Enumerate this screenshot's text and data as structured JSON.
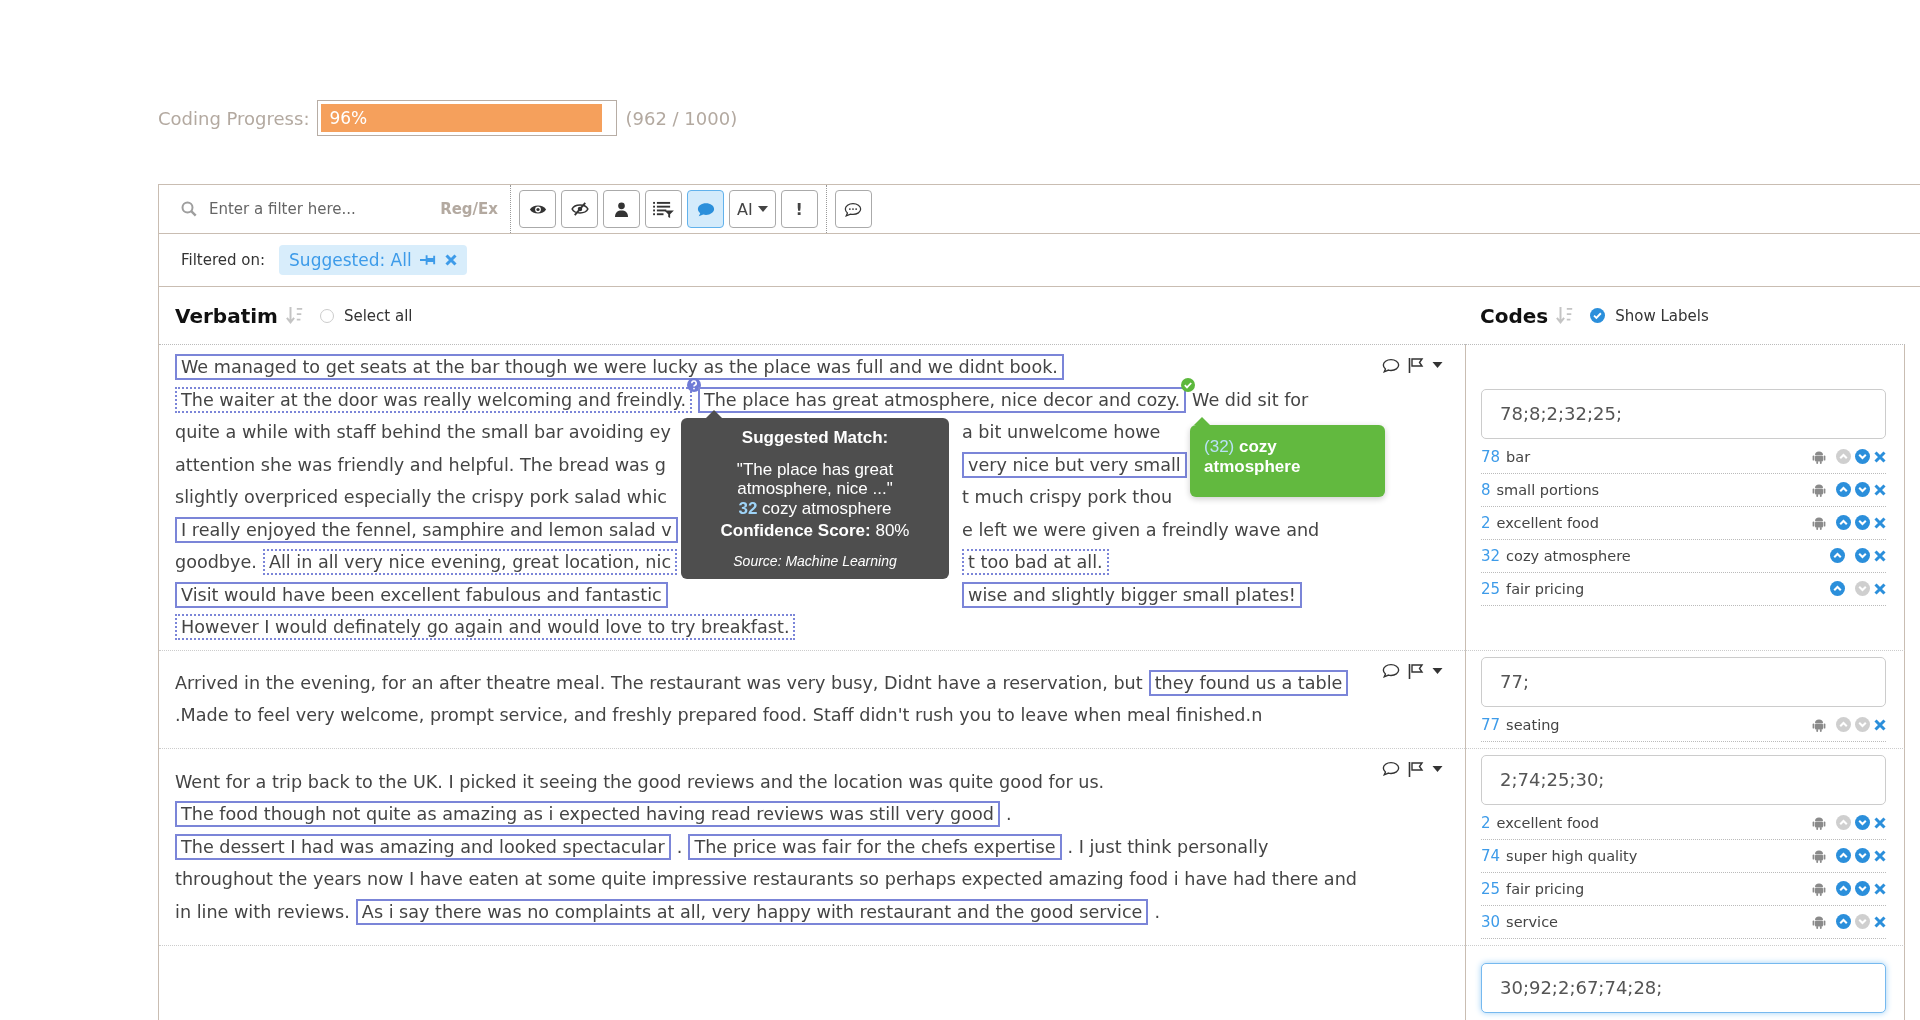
{
  "progress": {
    "label": "Coding Progress:",
    "level": 0.96,
    "percent": "96%",
    "count": "(962 / 1000)"
  },
  "toolbar": {
    "search_placeholder": "Enter a filter here...",
    "regex_label": "Reg/Ex",
    "buttons": [
      {
        "kind": "eye",
        "selected": false
      },
      {
        "kind": "eye-slash",
        "selected": false
      },
      {
        "kind": "user",
        "selected": false
      },
      {
        "kind": "list-filter",
        "selected": false
      },
      {
        "kind": "comment",
        "selected": true
      },
      {
        "kind": "dropdown",
        "label": "AI",
        "selected": false
      },
      {
        "kind": "text",
        "label": "!",
        "selected": false
      }
    ]
  },
  "filter": {
    "label": "Filtered on:",
    "chip": "Suggested: All"
  },
  "verbatim_header": {
    "title": "Verbatim",
    "select_all": "Select all",
    "checked": false
  },
  "codes_header": {
    "title": "Codes",
    "show_labels": "Show Labels",
    "checked": true
  },
  "rows": [
    {
      "lines": [
        {
          "segments": [
            {
              "text": "We managed to get seats at the bar though we were lucky as the place was full and we didnt book.",
              "kind": "solid"
            }
          ]
        },
        {
          "segments": [
            {
              "text": "The waiter at the door was really welcoming and freindly.",
              "kind": "dotted",
              "suggested": true
            },
            {
              "text": "The place has great atmosphere, nice decor and cozy.",
              "kind": "solid",
              "confirmed": true
            },
            {
              "text": "We did sit for",
              "kind": "plain"
            }
          ]
        },
        {
          "segments": [
            {
              "text": "quite a while with staff behind the small bar avoiding ey",
              "kind": "plain"
            }
          ],
          "after_gap": [
            {
              "text": "a bit unwelcome howe",
              "kind": "plain"
            }
          ]
        },
        {
          "segments": [
            {
              "text": "attention she was friendly and helpful. The bread was g",
              "kind": "plain"
            }
          ],
          "after_gap": [
            {
              "text": "very nice but very small",
              "kind": "solid"
            }
          ]
        },
        {
          "segments": [
            {
              "text": "slightly overpriced especially the crispy pork salad whic",
              "kind": "plain"
            }
          ],
          "after_gap": [
            {
              "text": "t much crispy pork thou",
              "kind": "plain"
            }
          ]
        },
        {
          "segments": [
            {
              "text": "I really enjoyed the fennel, samphire and lemon salad v",
              "kind": "solid"
            }
          ],
          "after_gap": [
            {
              "text": "e left we were given a freindly wave and",
              "kind": "plain"
            }
          ]
        },
        {
          "segments": [
            {
              "text": "goodbye.",
              "kind": "plain"
            },
            {
              "text": "All in all very nice evening, great location, nic",
              "kind": "dotted"
            }
          ],
          "after_gap": [
            {
              "text": "t too bad at all.",
              "kind": "dotted"
            }
          ]
        },
        {
          "segments": [
            {
              "text": "Visit would have been excellent fabulous and fantastic",
              "kind": "solid"
            }
          ],
          "after_gap": [
            {
              "text": "wise and slightly bigger small plates!",
              "kind": "solid"
            }
          ]
        },
        {
          "segments": [
            {
              "text": "However I would definately go again and would love to try breakfast.",
              "kind": "dotted"
            }
          ]
        }
      ],
      "suggestion": {
        "title": "Suggested Match:",
        "quote": "\"The place has great atmosphere, nice ...\"",
        "code": "32",
        "label": "cozy atmosphere",
        "confidence": "**Confidence Score:** 80%",
        "source": "Source: Machine Learning"
      },
      "code_popup": {
        "code": "(32)",
        "label": "cozy atmosphere"
      },
      "codes_input": "78;8;2;32;25;",
      "focused": false,
      "codes": [
        {
          "number": "78",
          "label": "bar",
          "machine": true,
          "can_up": false,
          "can_down": true
        },
        {
          "number": "8",
          "label": "small portions",
          "machine": true,
          "can_up": true,
          "can_down": true
        },
        {
          "number": "2",
          "label": "excellent food",
          "machine": true,
          "can_up": true,
          "can_down": true
        },
        {
          "number": "32",
          "label": "cozy atmosphere",
          "machine": false,
          "can_up": true,
          "can_down": true
        },
        {
          "number": "25",
          "label": "fair pricing",
          "machine": false,
          "can_up": true,
          "can_down": false
        }
      ]
    },
    {
      "lines": [
        {
          "segments": [
            {
              "text": "Arrived in the evening, for an after theatre meal. The restaurant was very busy, Didnt have a reservation, but",
              "kind": "plain"
            },
            {
              "text": "they found us a table",
              "kind": "solid"
            }
          ]
        },
        {
          "segments": [
            {
              "text": ".Made to feel very welcome, prompt service, and freshly prepared food. Staff didn't rush you to leave when meal finished.n",
              "kind": "plain"
            }
          ]
        }
      ],
      "codes_input": "77;",
      "focused": false,
      "codes": [
        {
          "number": "77",
          "label": "seating",
          "machine": true,
          "can_up": false,
          "can_down": false
        }
      ]
    },
    {
      "lines": [
        {
          "segments": [
            {
              "text": "Went for a trip back to the UK. I picked it seeing the good reviews and the location was quite good for us.",
              "kind": "plain"
            }
          ]
        },
        {
          "segments": [
            {
              "text": "The food though not quite as amazing as i expected having read reviews was still very good",
              "kind": "solid"
            },
            {
              "text": ".",
              "kind": "plain"
            }
          ]
        },
        {
          "segments": [
            {
              "text": "The dessert I had was amazing and looked spectacular",
              "kind": "solid"
            },
            {
              "text": ".",
              "kind": "plain"
            },
            {
              "text": "The price was fair for the chefs expertise",
              "kind": "solid"
            },
            {
              "text": ". I just think personally",
              "kind": "plain"
            }
          ]
        },
        {
          "segments": [
            {
              "text": "throughout the years now I have eaten at some quite impressive restaurants so perhaps expected amazing food i have had there and",
              "kind": "plain"
            }
          ]
        },
        {
          "segments": [
            {
              "text": "in line with reviews.",
              "kind": "plain"
            },
            {
              "text": "As i say there was no complaints at all, very happy with restaurant and the good service",
              "kind": "solid"
            },
            {
              "text": ".",
              "kind": "plain"
            }
          ]
        }
      ],
      "codes_input": "2;74;25;30;",
      "focused": false,
      "codes": [
        {
          "number": "2",
          "label": "excellent food",
          "machine": true,
          "can_up": false,
          "can_down": true
        },
        {
          "number": "74",
          "label": "super high quality",
          "machine": true,
          "can_up": true,
          "can_down": true
        },
        {
          "number": "25",
          "label": "fair pricing",
          "machine": true,
          "can_up": true,
          "can_down": true
        },
        {
          "number": "30",
          "label": "service",
          "machine": true,
          "can_up": true,
          "can_down": false
        }
      ]
    },
    {
      "codes_input": "30;92;2;67;74;28;",
      "focused": true
    }
  ]
}
